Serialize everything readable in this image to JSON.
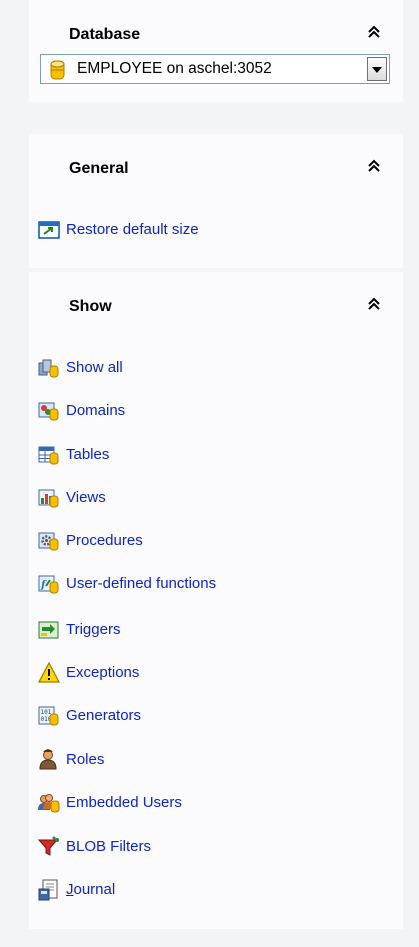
{
  "database_group": {
    "title": "Database",
    "selected_db": "EMPLOYEE on aschel:3052"
  },
  "general_group": {
    "title": "General",
    "items": [
      {
        "label": "Restore default size",
        "icon": "restore-size-icon"
      }
    ]
  },
  "show_group": {
    "title": "Show",
    "items": [
      {
        "label": "Show all",
        "icon": "show-all-icon"
      },
      {
        "label": "Domains",
        "icon": "domains-icon"
      },
      {
        "label": "Tables",
        "icon": "tables-icon"
      },
      {
        "label": "Views",
        "icon": "views-icon"
      },
      {
        "label": "Procedures",
        "icon": "procedures-icon"
      },
      {
        "label": "User-defined functions",
        "icon": "udf-icon"
      },
      {
        "label": "Triggers",
        "icon": "triggers-icon"
      },
      {
        "label": "Exceptions",
        "icon": "exceptions-icon"
      },
      {
        "label": "Generators",
        "icon": "generators-icon"
      },
      {
        "label": "Roles",
        "icon": "roles-icon"
      },
      {
        "label": "Embedded Users",
        "icon": "embedded-users-icon"
      },
      {
        "label": "BLOB Filters",
        "icon": "blob-filters-icon"
      },
      {
        "label": "Journal",
        "icon": "journal-icon"
      }
    ]
  },
  "colors": {
    "link": "#0b24d2",
    "panel_bg": "#f3f4f8",
    "group_bg": "#fbfbfd"
  }
}
